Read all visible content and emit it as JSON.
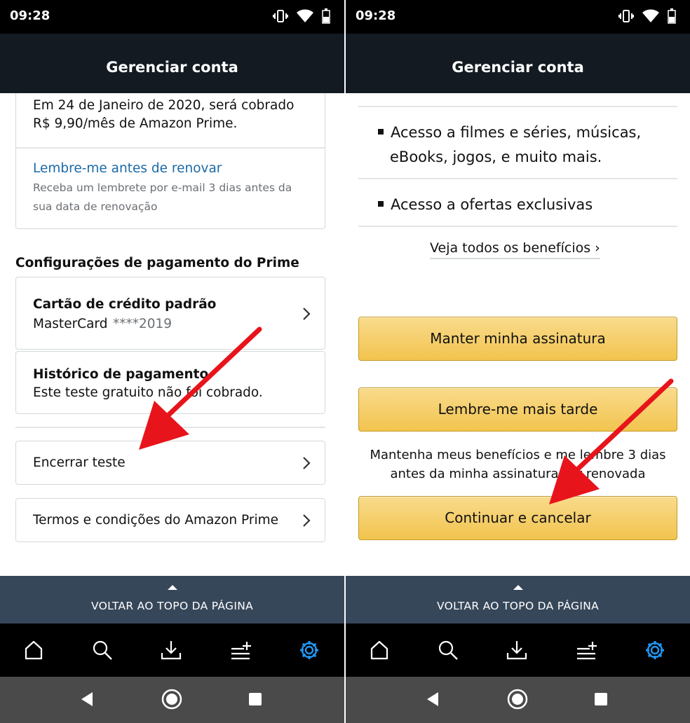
{
  "status": {
    "left_time": "09:28",
    "right_time": "09:28"
  },
  "header": {
    "left_title": "Gerenciar conta",
    "right_title": "Gerenciar conta"
  },
  "left": {
    "renewal": {
      "line1": "Em 24 de Janeiro de 2020, será cobrado",
      "line2": "R$ 9,90/mês de Amazon Prime."
    },
    "reminder": {
      "link": "Lembre-me antes de renovar",
      "desc1": "Receba um lembrete por e-mail 3 dias antes da",
      "desc2": "sua data de renovação"
    },
    "payment_section_title": "Configurações de pagamento do Prime",
    "credit_card": {
      "title": "Cartão de crédito padrão",
      "brand": "MasterCard",
      "number": "****2019"
    },
    "history": {
      "title": "Histórico de pagamento",
      "desc": "Este teste gratuito não foi cobrado."
    },
    "end_trial": "Encerrar teste",
    "terms": "Termos e condições do Amazon Prime"
  },
  "right": {
    "benefits": [
      {
        "line1": "Acesso a filmes e séries, músicas,",
        "line2": "eBooks, jogos, e muito mais."
      },
      {
        "line1": "Acesso a ofertas exclusivas",
        "line2": ""
      }
    ],
    "see_all": "Veja todos os benefícios ›",
    "keep_button": "Manter minha assinatura",
    "remind_button": "Lembre-me mais tarde",
    "remind_note1": "Mantenha meus benefícios e me lembre 3 dias",
    "remind_note2": "antes da minha assinatura ser renovada",
    "continue_button": "Continuar e cancelar"
  },
  "back_to_top": {
    "left_label": "VOLTAR AO TOPO DA PÁGINA",
    "right_label": "VOLTAR AO TOPO DA PÁGINA"
  },
  "bottom_nav": {
    "items": [
      "home-icon",
      "search-icon",
      "download-icon",
      "list-add-icon",
      "gear-icon"
    ],
    "active": "gear-icon",
    "active_color": "#2196f3"
  },
  "annotation_color": "#e8141b"
}
